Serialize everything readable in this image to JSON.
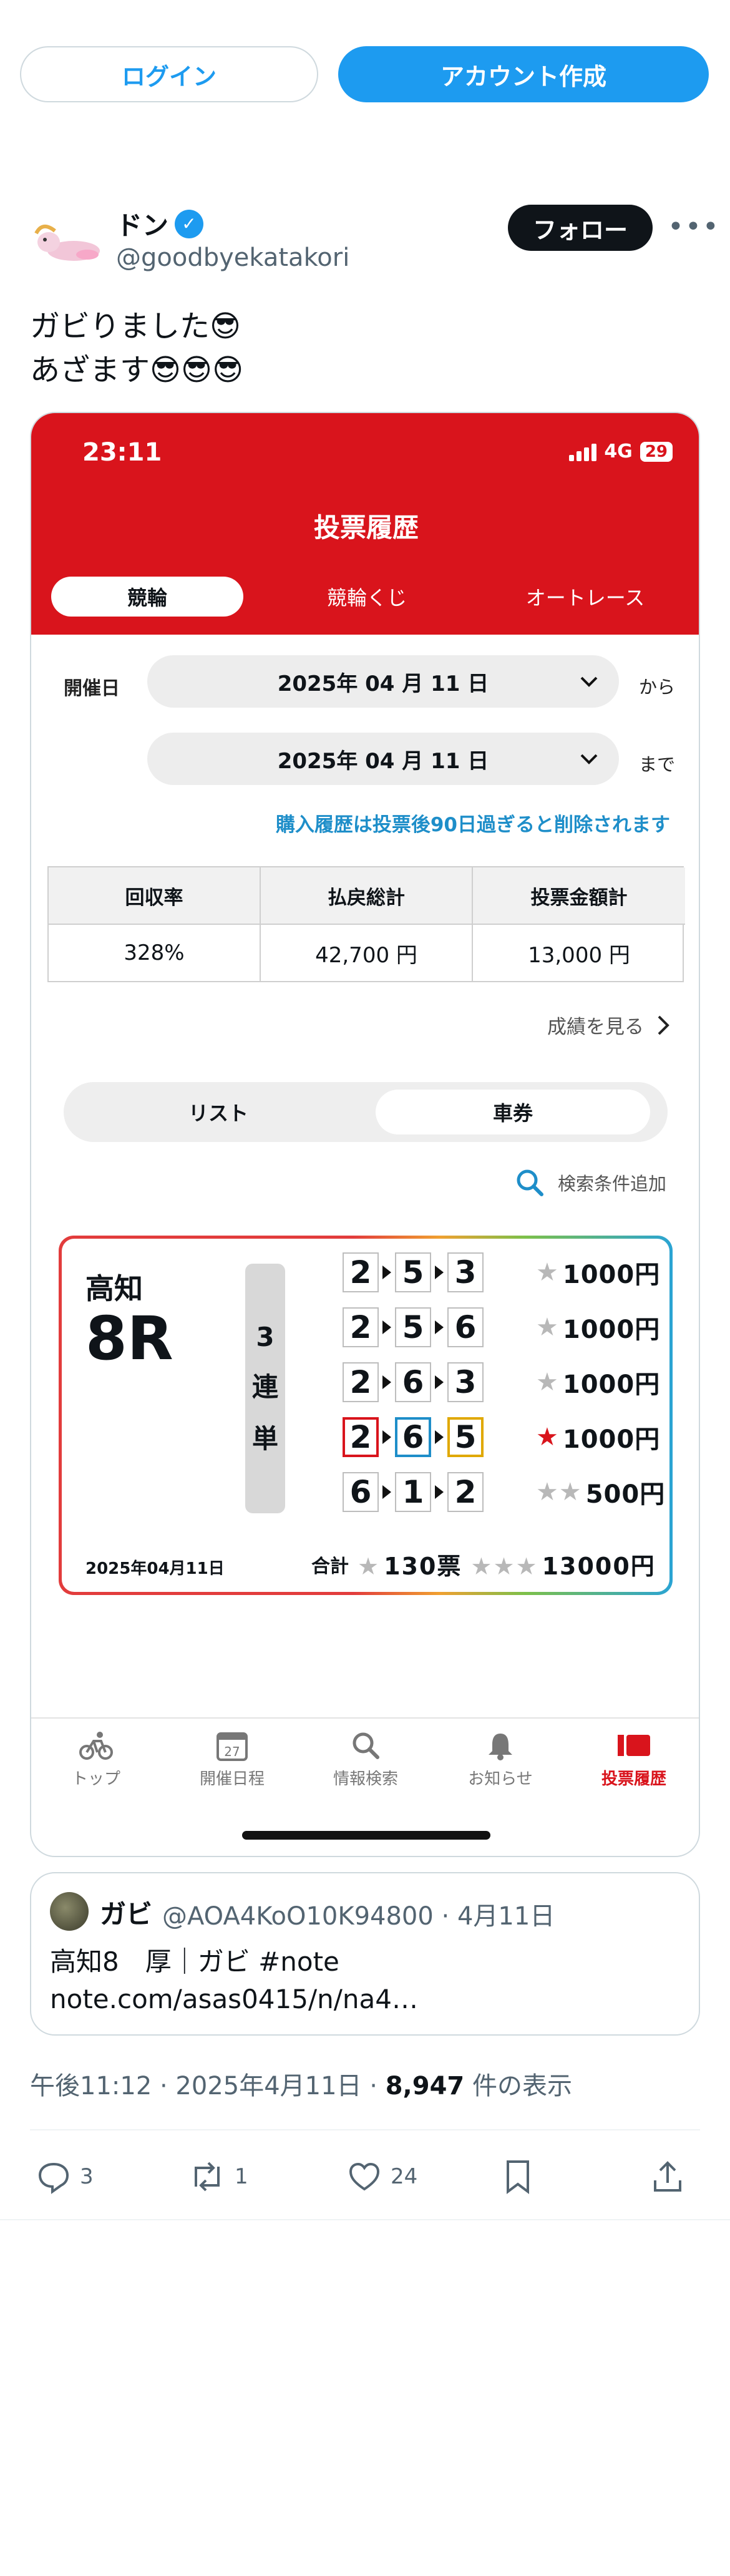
{
  "top_actions": {
    "login_label": "ログイン",
    "create_account_label": "アカウント作成"
  },
  "author": {
    "name": "ドン",
    "handle": "@goodbyekatakori",
    "follow_label": "フォロー"
  },
  "tweet": {
    "line1": "ガビりました😎",
    "line2": "あざます😎😎😎"
  },
  "app": {
    "status_time": "23:11",
    "network": "4G",
    "battery": "29",
    "title": "投票履歴",
    "tabs": [
      "競輪",
      "競輪くじ",
      "オートレース"
    ],
    "date_label": "開催日",
    "date_from": "2025年 04 月 11 日",
    "date_to": "2025年 04 月 11 日",
    "from_suffix": "から",
    "to_suffix": "まで",
    "notice": "購入履歴は投票後90日過ぎると削除されます",
    "summary": [
      {
        "header": "回収率",
        "value": "328%"
      },
      {
        "header": "払戻総計",
        "value": "42,700 円"
      },
      {
        "header": "投票金額計",
        "value": "13,000 円"
      }
    ],
    "results_link": "成績を見る",
    "view_toggle": [
      "リスト",
      "車券"
    ],
    "search_add": "検索条件追加",
    "ticket": {
      "venue": "高知",
      "race": "8R",
      "bet_type": [
        "3",
        "連",
        "単"
      ],
      "rows": [
        {
          "nums": [
            "2",
            "5",
            "3"
          ],
          "stars": "★",
          "amount": "1000円",
          "hit": false
        },
        {
          "nums": [
            "2",
            "5",
            "6"
          ],
          "stars": "★",
          "amount": "1000円",
          "hit": false
        },
        {
          "nums": [
            "2",
            "6",
            "3"
          ],
          "stars": "★",
          "amount": "1000円",
          "hit": false
        },
        {
          "nums": [
            "2",
            "6",
            "5"
          ],
          "stars": "★",
          "amount": "1000円",
          "hit": true
        },
        {
          "nums": [
            "6",
            "1",
            "2"
          ],
          "stars": "★★",
          "amount": "500円",
          "hit": false
        }
      ],
      "date": "2025年04月11日",
      "total_label": "合計",
      "total_tickets": "130票",
      "total_amount": "13000円"
    },
    "tabbar": [
      "トップ",
      "開催日程",
      "情報検索",
      "お知らせ",
      "投票履歴"
    ],
    "calendar_day": "27"
  },
  "quote": {
    "name": "ガビ",
    "meta": "@AOA4KoO10K94800 · 4月11日",
    "text1": "高知8　厚｜ガビ #note",
    "text2": "note.com/asas0415/n/na4…"
  },
  "meta": {
    "time": "午後11:12 · 2025年4月11日 · ",
    "views": "8,947",
    "views_suffix": " 件の表示"
  },
  "actions": {
    "replies": "3",
    "reposts": "1",
    "likes": "24"
  },
  "colors": {
    "accent": "#1d9bf0",
    "app_red": "#d9141c",
    "notice_blue": "#1e8ec9"
  }
}
